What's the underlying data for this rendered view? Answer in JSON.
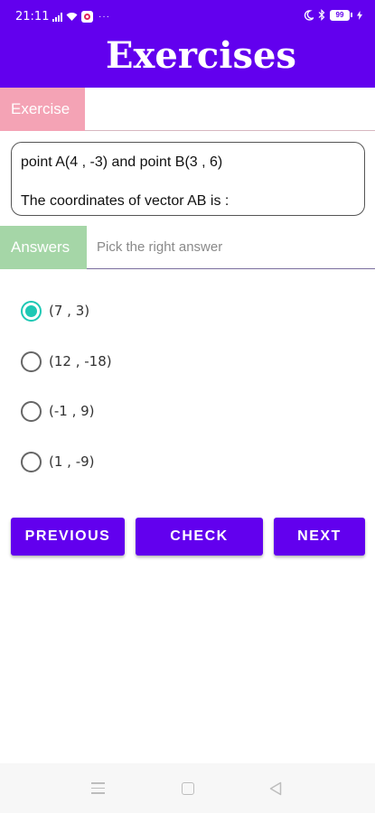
{
  "status_bar": {
    "time": "21:11",
    "battery_level": "99",
    "icons": [
      "signal-icon",
      "wifi-icon",
      "app-notification-icon",
      "more-dots-icon",
      "moon-icon",
      "bluetooth-icon",
      "battery-icon",
      "charging-icon"
    ]
  },
  "app_bar": {
    "title": "Exercises",
    "color": "#6200ee"
  },
  "exercise": {
    "label": "Exercise",
    "label_color": "#f4a3b5",
    "question_line1": "point A(4 , -3) and point B(3 , 6)",
    "question_line2": "The coordinates of vector AB is :"
  },
  "answers": {
    "label": "Answers",
    "label_color": "#a5d6a7",
    "hint": "Pick the right answer",
    "selected_index": 0,
    "options": [
      "(7 , 3)",
      "(12 , -18)",
      "(-1 , 9)",
      "(1 , -9)"
    ],
    "selected_color": "#1ec8b4"
  },
  "buttons": {
    "previous": "PREVIOUS",
    "check": "CHECK",
    "next": "NEXT"
  },
  "nav_bar": {
    "icons": [
      "menu-icon",
      "home-icon",
      "back-icon"
    ]
  }
}
